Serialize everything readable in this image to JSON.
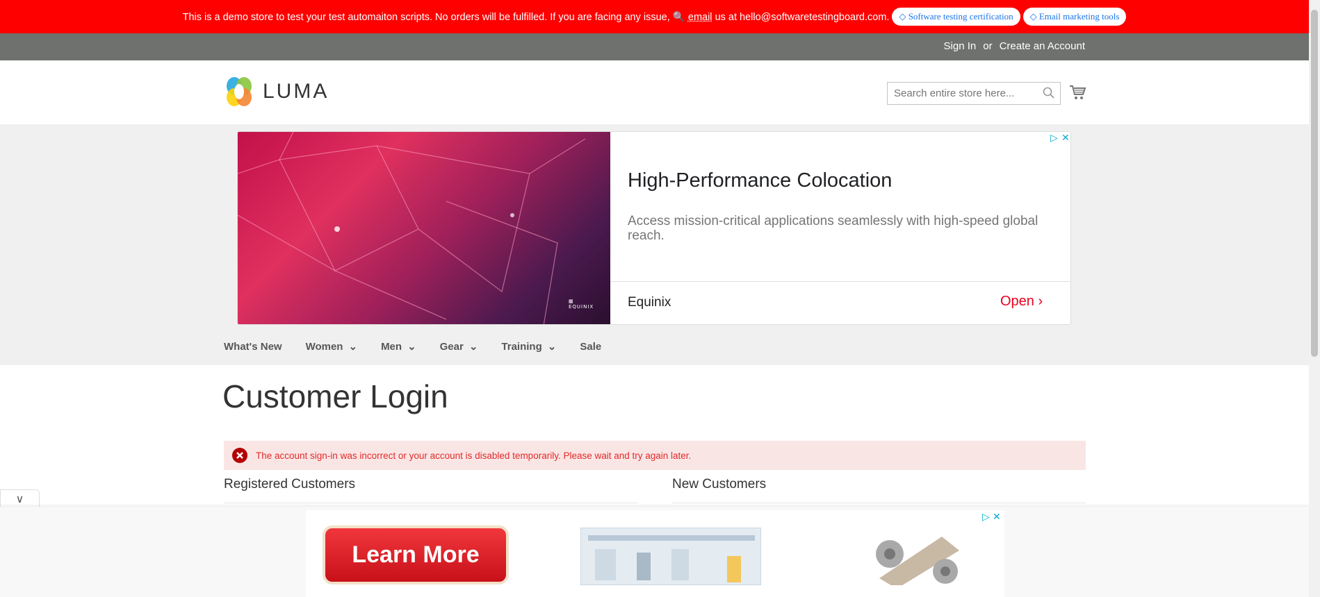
{
  "topbar": {
    "message": "This is a demo store to test your test automaiton scripts. No orders will be fulfilled. If you are facing any issue,",
    "email_link": "email",
    "message_end": "us at hello@softwaretestingboard.com.",
    "pill1": "Software testing certification",
    "pill2": "Email marketing tools",
    "bg_color": "#ff0000"
  },
  "panel": {
    "sign_in": "Sign In",
    "or": "or",
    "create_account": "Create an Account"
  },
  "header": {
    "logo_text": "LUMA",
    "search_placeholder": "Search entire store here..."
  },
  "ad_top": {
    "title": "High-Performance Colocation",
    "description": "Access mission-critical applications seamlessly with high-speed global reach.",
    "advertiser": "Equinix",
    "cta": "Open",
    "image_logo": "EQUINIX"
  },
  "nav": {
    "items": [
      {
        "label": "What's New"
      },
      {
        "label": "Women",
        "dropdown": true
      },
      {
        "label": "Men",
        "dropdown": true
      },
      {
        "label": "Gear",
        "dropdown": true
      },
      {
        "label": "Training",
        "dropdown": true
      },
      {
        "label": "Sale"
      }
    ]
  },
  "main": {
    "page_title": "Customer Login",
    "error_message": "The account sign-in was incorrect or your account is disabled temporarily. Please wait and try again later.",
    "registered_title": "Registered Customers",
    "new_title": "New Customers"
  },
  "ad_bottom": {
    "learn_more": "Learn More"
  },
  "colors": {
    "error_bg": "#fae5e5",
    "error_text": "#e02b27",
    "panel": "#6e716e",
    "ad_cta": "#e8001c"
  }
}
